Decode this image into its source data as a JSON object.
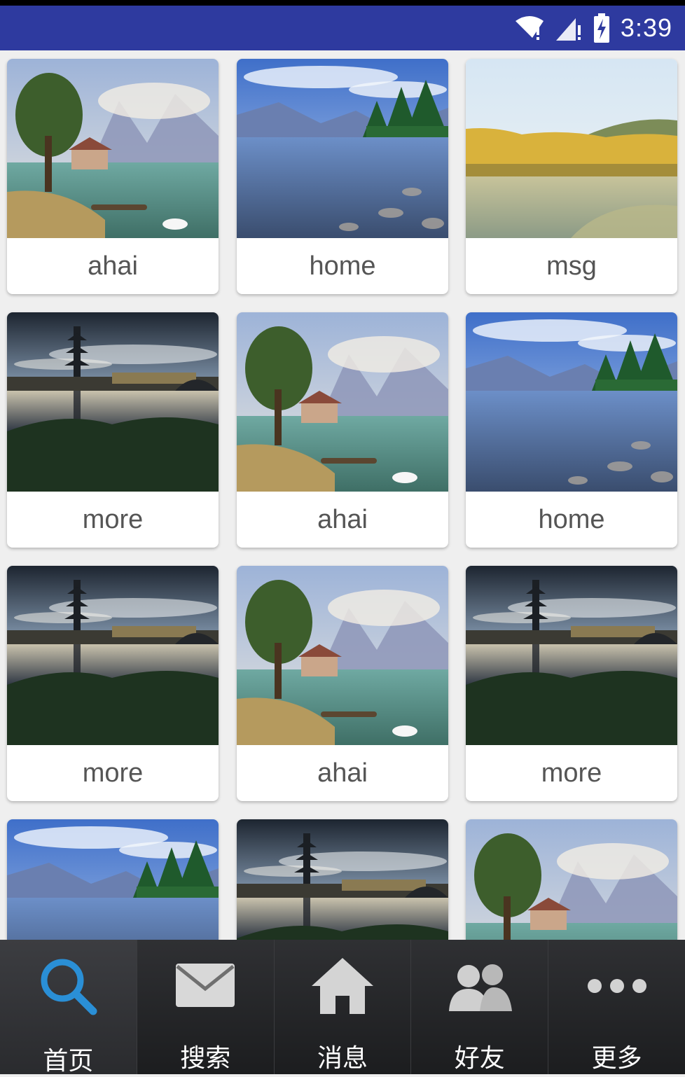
{
  "status_bar": {
    "time": "3:39",
    "icons": [
      "wifi-alert-icon",
      "signal-alert-icon",
      "battery-charging-icon"
    ],
    "color": "#2e3a9f"
  },
  "grid": {
    "items": [
      {
        "label": "ahai",
        "image": "painting-lake-landscape"
      },
      {
        "label": "home",
        "image": "mountain-lake-clear-water"
      },
      {
        "label": "msg",
        "image": "autumn-forest-lake"
      },
      {
        "label": "more",
        "image": "pagoda-reflection-dusk"
      },
      {
        "label": "ahai",
        "image": "painting-lake-landscape"
      },
      {
        "label": "home",
        "image": "mountain-lake-clear-water"
      },
      {
        "label": "more",
        "image": "pagoda-reflection-dusk"
      },
      {
        "label": "ahai",
        "image": "painting-lake-landscape"
      },
      {
        "label": "more",
        "image": "pagoda-reflection-dusk"
      },
      {
        "label": "",
        "image": "mountain-lake-clear-water"
      },
      {
        "label": "",
        "image": "pagoda-reflection-dusk"
      },
      {
        "label": "",
        "image": "painting-lake-landscape"
      }
    ]
  },
  "bottom_nav": {
    "items": [
      {
        "label": "首页",
        "icon": "search-icon",
        "active": true
      },
      {
        "label": "搜索",
        "icon": "mail-icon",
        "active": false
      },
      {
        "label": "消息",
        "icon": "home-icon",
        "active": false
      },
      {
        "label": "好友",
        "icon": "friends-icon",
        "active": false
      },
      {
        "label": "更多",
        "icon": "more-icon",
        "active": false
      }
    ],
    "accent": "#2a8fd6"
  }
}
